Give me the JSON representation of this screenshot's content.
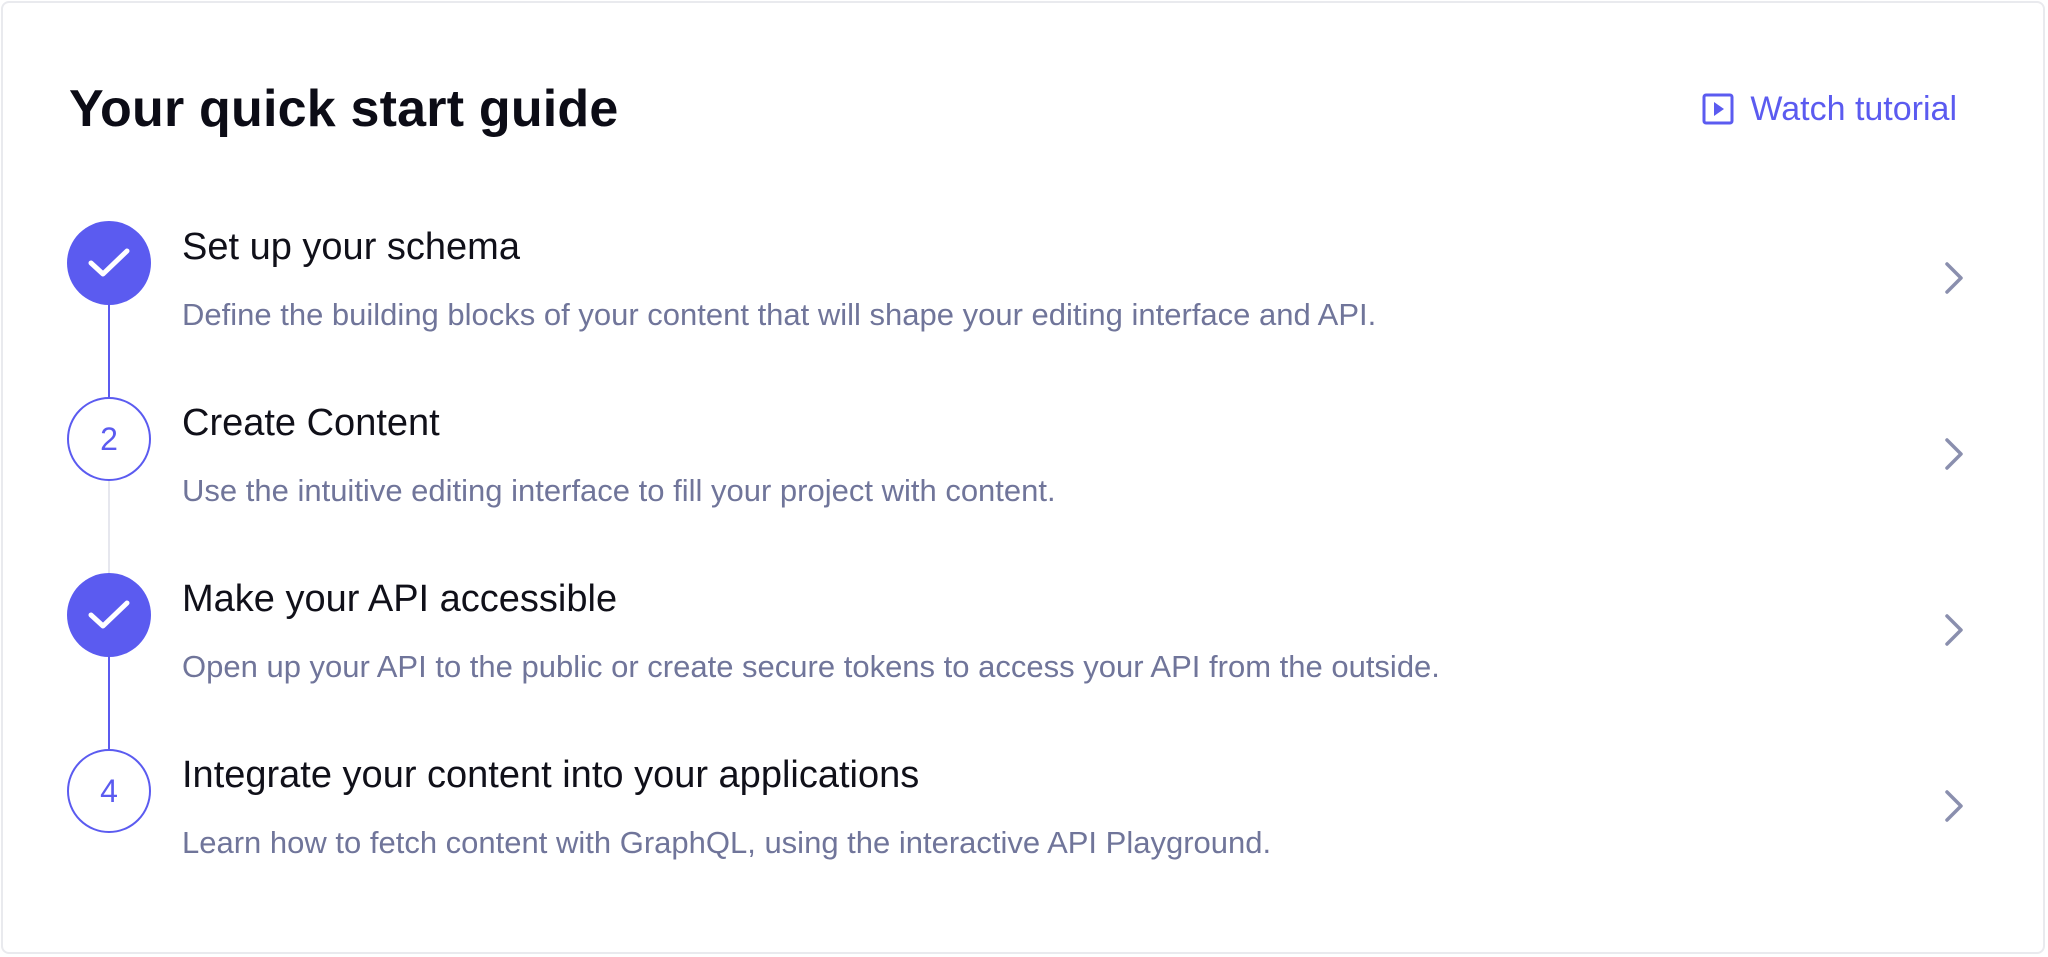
{
  "header": {
    "title": "Your quick start guide",
    "watch_tutorial_label": "Watch tutorial",
    "watch_tutorial_icon": "play-square-icon"
  },
  "steps": [
    {
      "status": "completed",
      "marker": "",
      "marker_icon": "check-icon",
      "title": "Set up your schema",
      "description": "Define the building blocks of your content that will shape your editing interface and API."
    },
    {
      "status": "incomplete",
      "marker": "2",
      "title": "Create Content",
      "description": "Use the intuitive editing interface to fill your project with content."
    },
    {
      "status": "completed",
      "marker": "",
      "marker_icon": "check-icon",
      "title": "Make your API accessible",
      "description": "Open up your API to the public or create secure tokens to access your API from the outside."
    },
    {
      "status": "incomplete",
      "marker": "4",
      "title": "Integrate your content into your applications",
      "description": "Learn how to fetch content with GraphQL, using the interactive API Playground."
    }
  ],
  "colors": {
    "accent": "#5b5bf0",
    "title_text": "#0c0c16",
    "description_text": "#70759a",
    "chevron": "#8a8fae",
    "connector_inactive": "#e6e7ee"
  }
}
